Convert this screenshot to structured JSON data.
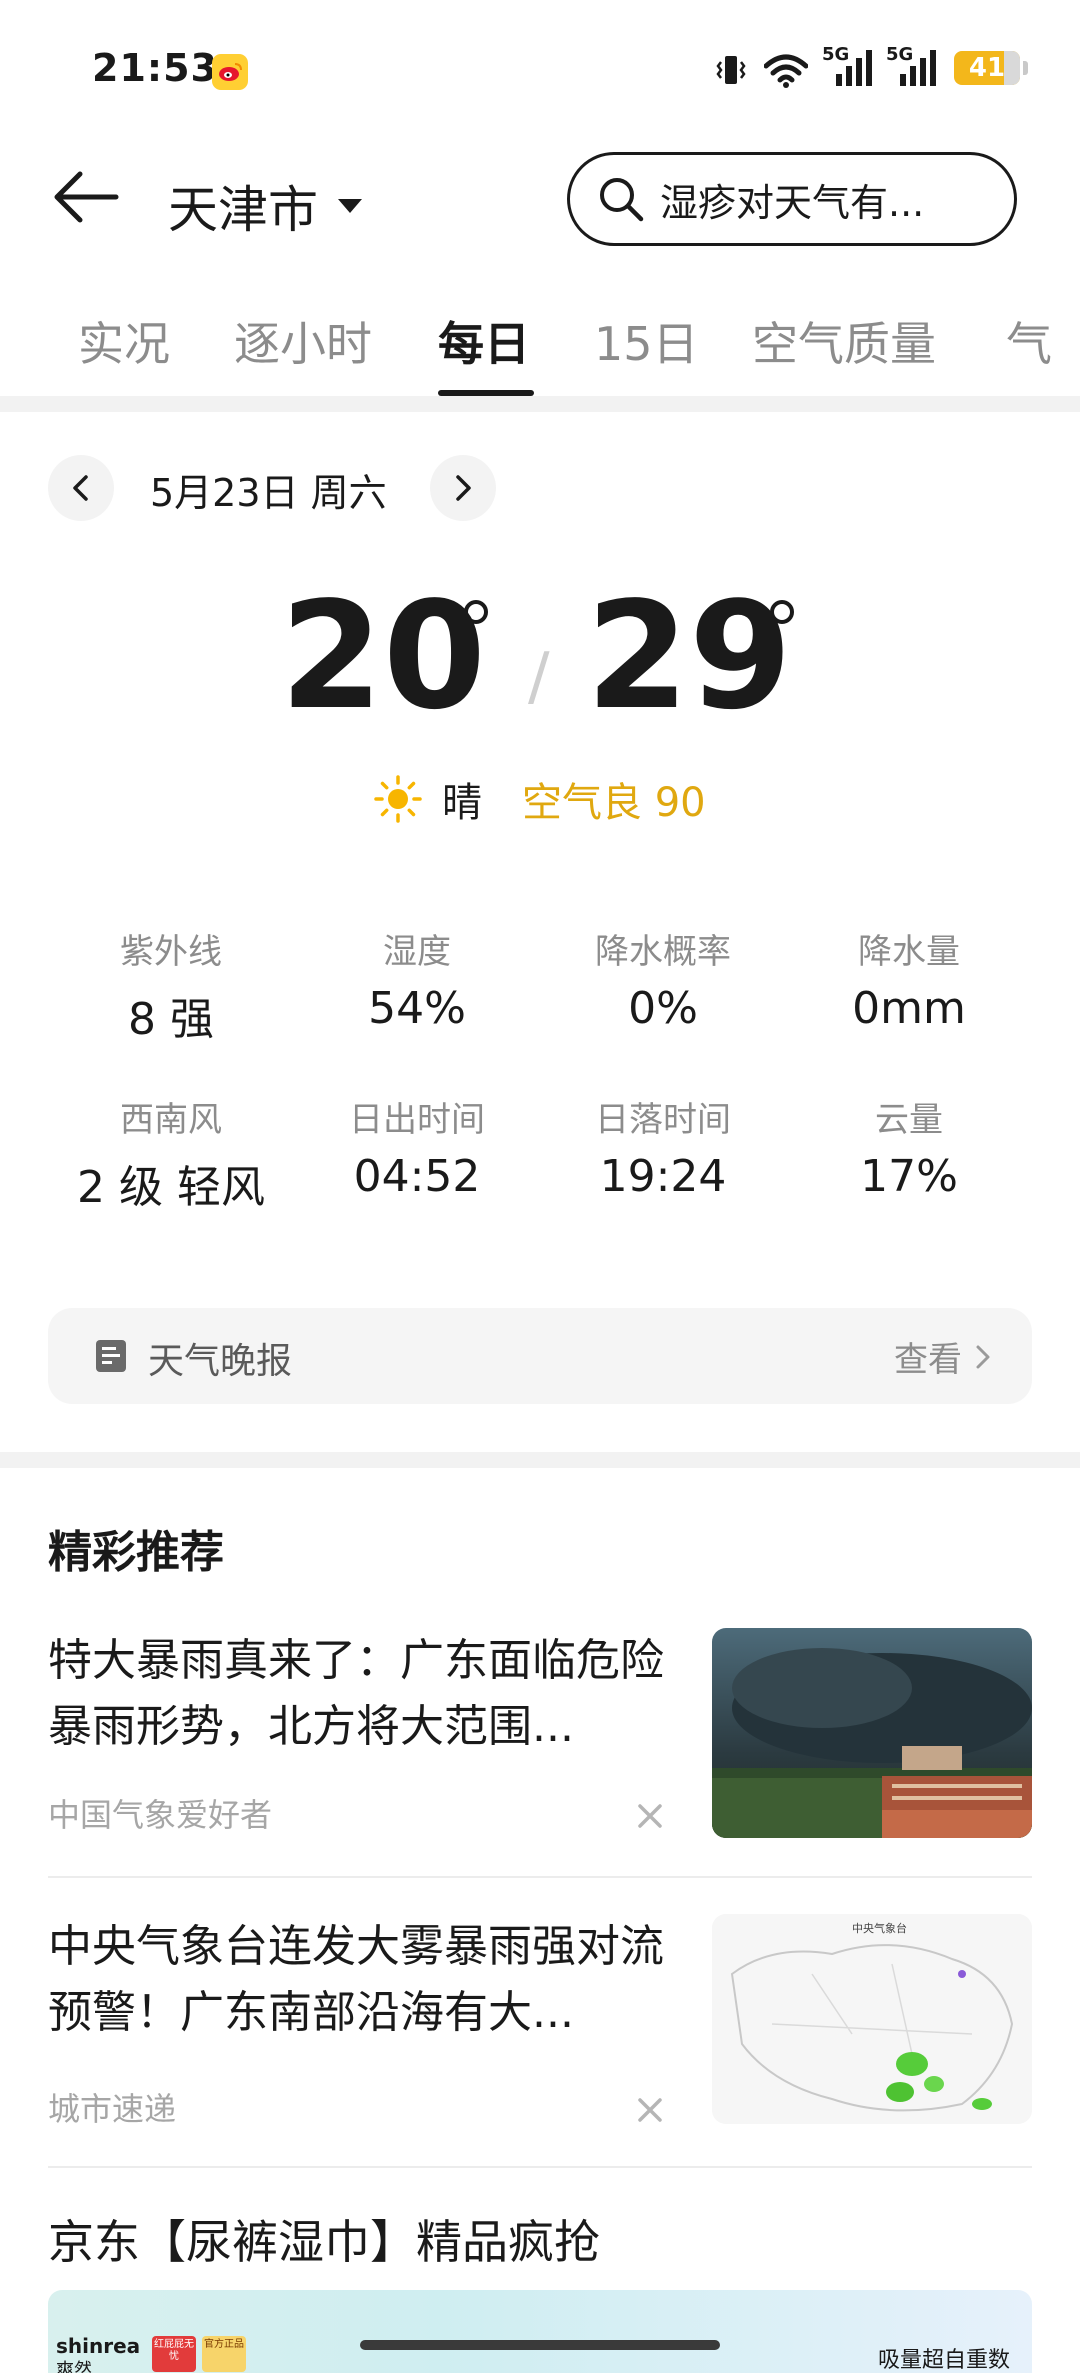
{
  "status_bar": {
    "time": "21:53",
    "network_1": "5G",
    "network_2": "5G",
    "battery": "41"
  },
  "header": {
    "city": "天津市",
    "search_placeholder": "湿疹对天气有..."
  },
  "tabs": [
    {
      "label": "实况"
    },
    {
      "label": "逐小时"
    },
    {
      "label": "每日",
      "active": true
    },
    {
      "label": "15日"
    },
    {
      "label": "空气质量"
    },
    {
      "label": "气"
    }
  ],
  "day": {
    "date": "5月23日 周六",
    "temp_low": "20",
    "temp_high": "29",
    "condition": "晴",
    "aqi_label": "空气良 90"
  },
  "stats": [
    {
      "label": "紫外线",
      "value": "8 强"
    },
    {
      "label": "湿度",
      "value": "54%"
    },
    {
      "label": "降水概率",
      "value": "0%"
    },
    {
      "label": "降水量",
      "value": "0mm"
    },
    {
      "label": "西南风",
      "value": "2 级 轻风"
    },
    {
      "label": "日出时间",
      "value": "04:52"
    },
    {
      "label": "日落时间",
      "value": "19:24"
    },
    {
      "label": "云量",
      "value": "17%"
    }
  ],
  "report": {
    "label": "天气晚报",
    "action": "查看"
  },
  "recommend": {
    "title": "精彩推荐",
    "items": [
      {
        "title": "特大暴雨真来了：广东面临危险暴雨形势，北方将大范围...",
        "source": "中国气象爱好者"
      },
      {
        "title": "中央气象台连发大雾暴雨强对流预警！广东南部沿海有大...",
        "source": "城市速递"
      }
    ],
    "map_caption": "中央气象台"
  },
  "ad": {
    "title": "京东【尿裤湿巾】精品疯抢",
    "brand": "shinrea",
    "brand_cn": "爽然",
    "tag1": "红屁屁无忧",
    "tag2": "官方正品",
    "slogan": "吸量超自重数"
  },
  "colors": {
    "accent": "#e0a810",
    "sun": "#f7b500",
    "text": "#1a1a1a",
    "muted": "#8c8c8c"
  }
}
